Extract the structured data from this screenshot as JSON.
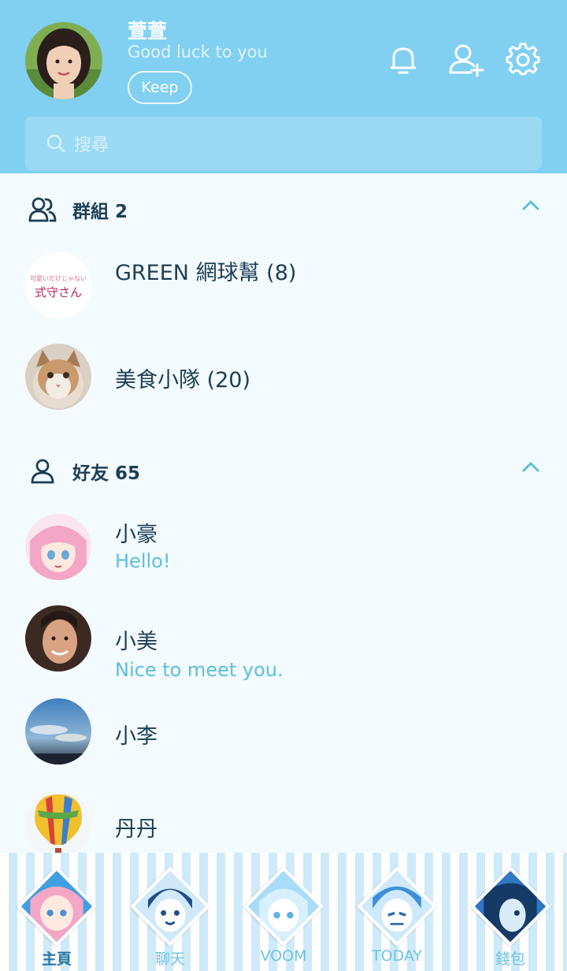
{
  "profile": {
    "name": "萱萱",
    "status": "Good luck to you",
    "keep_label": "Keep"
  },
  "header_icons": [
    "bell-icon",
    "add-friend-icon",
    "settings-icon"
  ],
  "search": {
    "placeholder": "搜尋"
  },
  "groups": {
    "title": "群組 2",
    "items": [
      {
        "name": "GREEN 網球幫 (8)",
        "avatar_text": "式守さん",
        "avatar_caption": "可愛いだけじゃない"
      },
      {
        "name": "美食小隊 (20)"
      }
    ]
  },
  "friends": {
    "title": "好友 65",
    "items": [
      {
        "name": "小豪",
        "message": "Hello!"
      },
      {
        "name": "小美",
        "message": "Nice to meet you."
      },
      {
        "name": "小李"
      },
      {
        "name": "丹丹"
      }
    ]
  },
  "nav": {
    "active": "主頁",
    "items": [
      {
        "label": "主頁"
      },
      {
        "label": "聊天"
      },
      {
        "label": "VOOM"
      },
      {
        "label": "TODAY"
      },
      {
        "label": "錢包"
      }
    ]
  },
  "colors": {
    "header_bg": "#81d0f1",
    "body_bg": "#f3fbfe",
    "text_dark": "#1d3e55",
    "accent": "#5dbfd8"
  }
}
